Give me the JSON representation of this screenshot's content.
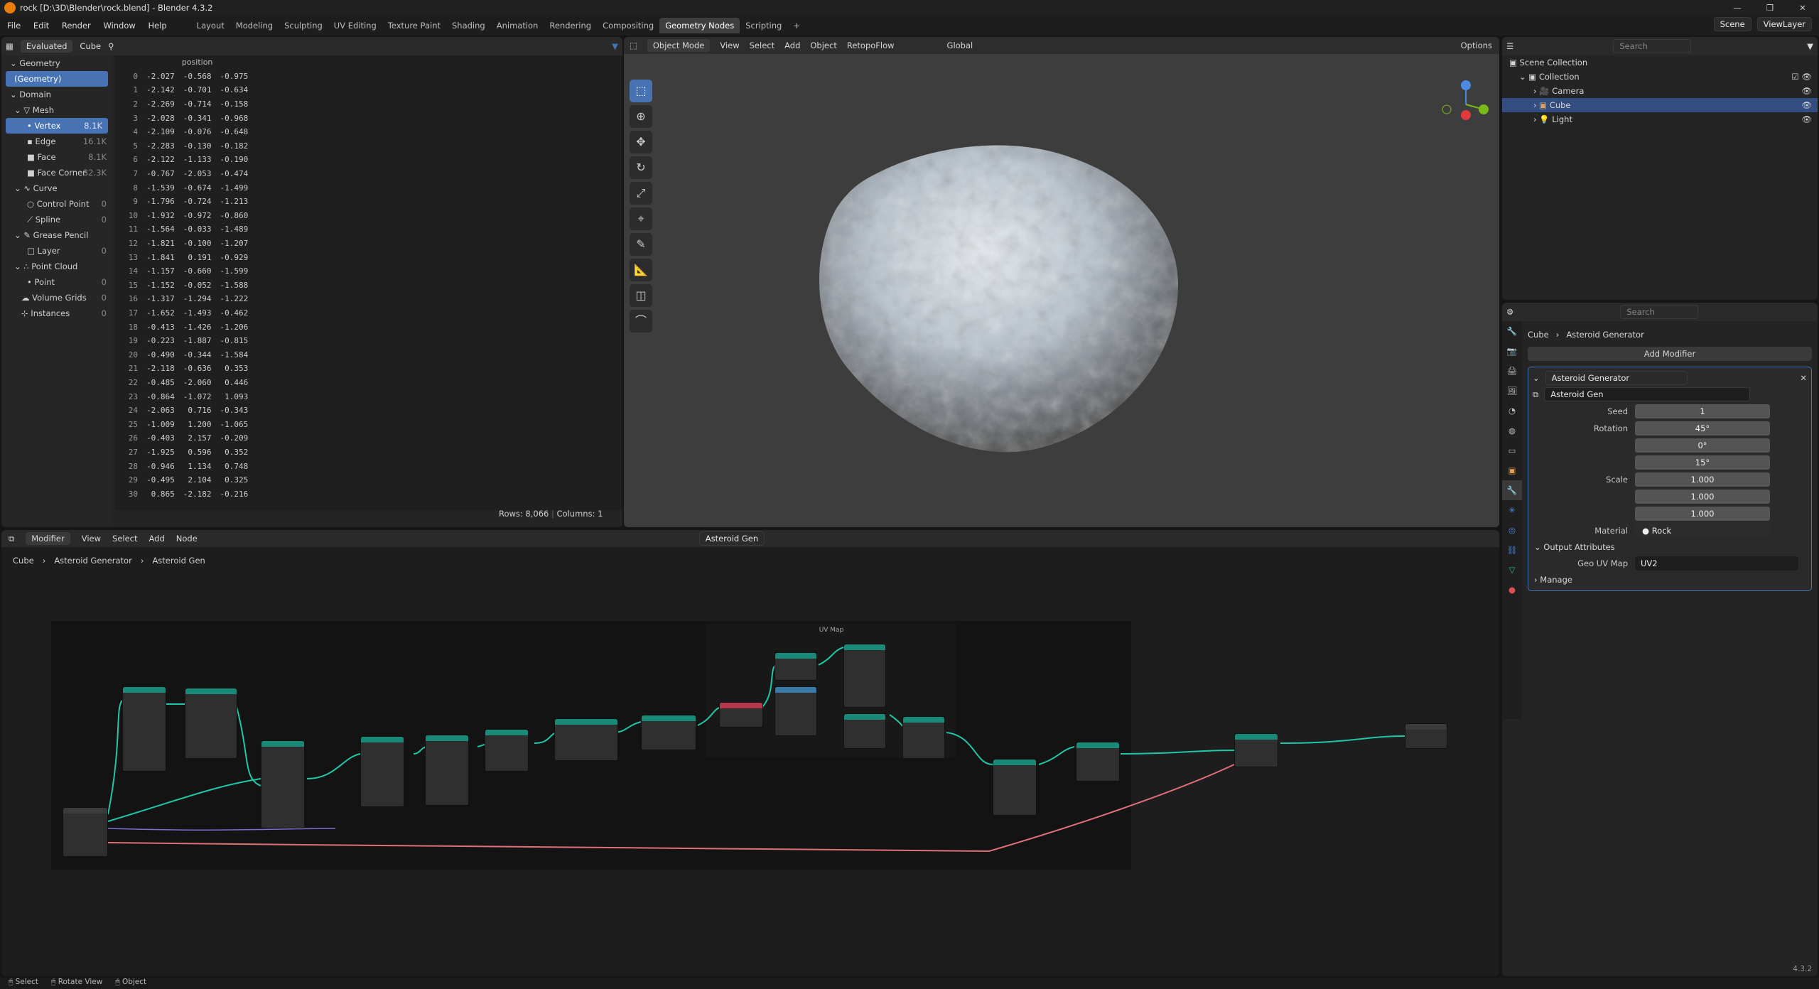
{
  "window": {
    "title": "rock [D:\\3D\\Blender\\rock.blend] - Blender 4.3.2",
    "controls": [
      "—",
      "❐",
      "✕"
    ]
  },
  "menu": [
    "File",
    "Edit",
    "Render",
    "Window",
    "Help"
  ],
  "workspace_tabs": [
    "Layout",
    "Modeling",
    "Sculpting",
    "UV Editing",
    "Texture Paint",
    "Shading",
    "Animation",
    "Rendering",
    "Compositing",
    "Geometry Nodes",
    "Scripting"
  ],
  "active_tab": "Geometry Nodes",
  "scene": "Scene",
  "view_layer": "ViewLayer",
  "spreadsheet": {
    "mode": "Evaluated",
    "object": "Cube",
    "column_header": "position",
    "rows_label": "Rows: 8,066",
    "cols_label": "Columns: 1",
    "tree": [
      {
        "label": "Geometry",
        "count": ""
      },
      {
        "label": "(Geometry)",
        "count": ""
      },
      {
        "label": "Domain",
        "count": ""
      },
      {
        "label": "Mesh",
        "count": ""
      },
      {
        "label": "Vertex",
        "count": "8.1K"
      },
      {
        "label": "Edge",
        "count": "16.1K"
      },
      {
        "label": "Face",
        "count": "8.1K"
      },
      {
        "label": "Face Corner",
        "count": "32.3K"
      },
      {
        "label": "Curve",
        "count": ""
      },
      {
        "label": "Control Point",
        "count": "0"
      },
      {
        "label": "Spline",
        "count": "0"
      },
      {
        "label": "Grease Pencil",
        "count": ""
      },
      {
        "label": "Layer",
        "count": "0"
      },
      {
        "label": "Point Cloud",
        "count": ""
      },
      {
        "label": "Point",
        "count": "0"
      },
      {
        "label": "Volume Grids",
        "count": "0"
      },
      {
        "label": "Instances",
        "count": "0"
      }
    ],
    "rows": [
      [
        "0",
        "-2.027",
        "-0.568",
        "-0.975"
      ],
      [
        "1",
        "-2.142",
        "-0.701",
        "-0.634"
      ],
      [
        "2",
        "-2.269",
        "-0.714",
        "-0.158"
      ],
      [
        "3",
        "-2.028",
        "-0.341",
        "-0.968"
      ],
      [
        "4",
        "-2.109",
        "-0.076",
        "-0.648"
      ],
      [
        "5",
        "-2.283",
        "-0.130",
        "-0.182"
      ],
      [
        "6",
        "-2.122",
        "-1.133",
        "-0.190"
      ],
      [
        "7",
        "-0.767",
        "-2.053",
        "-0.474"
      ],
      [
        "8",
        "-1.539",
        "-0.674",
        "-1.499"
      ],
      [
        "9",
        "-1.796",
        "-0.724",
        "-1.213"
      ],
      [
        "10",
        "-1.932",
        "-0.972",
        "-0.860"
      ],
      [
        "11",
        "-1.564",
        "-0.033",
        "-1.489"
      ],
      [
        "12",
        "-1.821",
        "-0.100",
        "-1.207"
      ],
      [
        "13",
        "-1.841",
        "0.191",
        "-0.929"
      ],
      [
        "14",
        "-1.157",
        "-0.660",
        "-1.599"
      ],
      [
        "15",
        "-1.152",
        "-0.052",
        "-1.588"
      ],
      [
        "16",
        "-1.317",
        "-1.294",
        "-1.222"
      ],
      [
        "17",
        "-1.652",
        "-1.493",
        "-0.462"
      ],
      [
        "18",
        "-0.413",
        "-1.426",
        "-1.206"
      ],
      [
        "19",
        "-0.223",
        "-1.887",
        "-0.815"
      ],
      [
        "20",
        "-0.490",
        "-0.344",
        "-1.584"
      ],
      [
        "21",
        "-2.118",
        "-0.636",
        "0.353"
      ],
      [
        "22",
        "-0.485",
        "-2.060",
        "0.446"
      ],
      [
        "23",
        "-0.864",
        "-1.072",
        "1.093"
      ],
      [
        "24",
        "-2.063",
        "0.716",
        "-0.343"
      ],
      [
        "25",
        "-1.009",
        "1.200",
        "-1.065"
      ],
      [
        "26",
        "-0.403",
        "2.157",
        "-0.209"
      ],
      [
        "27",
        "-1.925",
        "0.596",
        "0.352"
      ],
      [
        "28",
        "-0.946",
        "1.134",
        "0.748"
      ],
      [
        "29",
        "-0.495",
        "2.104",
        "0.325"
      ],
      [
        "30",
        "0.865",
        "-2.182",
        "-0.216"
      ]
    ]
  },
  "viewport": {
    "header": [
      "Object Mode",
      "View",
      "Select",
      "Add",
      "Object",
      "RetopoFlow",
      "Global",
      "Options"
    ],
    "tool_icons": [
      "select-box-icon",
      "cursor-icon",
      "move-icon",
      "rotate-icon",
      "scale-icon",
      "transform-icon",
      "annotate-icon",
      "measure-icon",
      "add-cube-icon",
      "shear-icon"
    ]
  },
  "outliner": {
    "search_placeholder": "Search",
    "items": [
      {
        "label": "Scene Collection",
        "indent": 0
      },
      {
        "label": "Collection",
        "indent": 1
      },
      {
        "label": "Camera",
        "indent": 2
      },
      {
        "label": "Cube",
        "indent": 2
      },
      {
        "label": "Light",
        "indent": 2
      }
    ]
  },
  "properties": {
    "search_placeholder": "Search",
    "breadcrumb_object": "Cube",
    "breadcrumb_modifier": "Asteroid Generator",
    "add_modifier": "Add Modifier",
    "modifier_name": "Asteroid Generator",
    "node_group": "Asteroid Gen",
    "fields": [
      {
        "label": "Seed",
        "value": "1"
      },
      {
        "label": "Rotation",
        "value": "45°"
      },
      {
        "label": "",
        "value": "0°"
      },
      {
        "label": "",
        "value": "15°"
      },
      {
        "label": "Scale",
        "value": "1.000"
      },
      {
        "label": "",
        "value": "1.000"
      },
      {
        "label": "",
        "value": "1.000"
      }
    ],
    "material_label": "Material",
    "material_value": "Rock",
    "output_attributes": "Output Attributes",
    "geo_uv_label": "Geo UV Map",
    "geo_uv_value": "UV2",
    "manage": "Manage",
    "version": "4.3.2"
  },
  "node_editor": {
    "header": [
      "Modifier",
      "View",
      "Select",
      "Add",
      "Node"
    ],
    "node_group": "Asteroid Gen",
    "breadcrumb": [
      "Cube",
      "Asteroid Generator",
      "Asteroid Gen"
    ],
    "frame_label": "UV Map"
  },
  "status_bar": [
    "Select",
    "Rotate View",
    "Object"
  ]
}
